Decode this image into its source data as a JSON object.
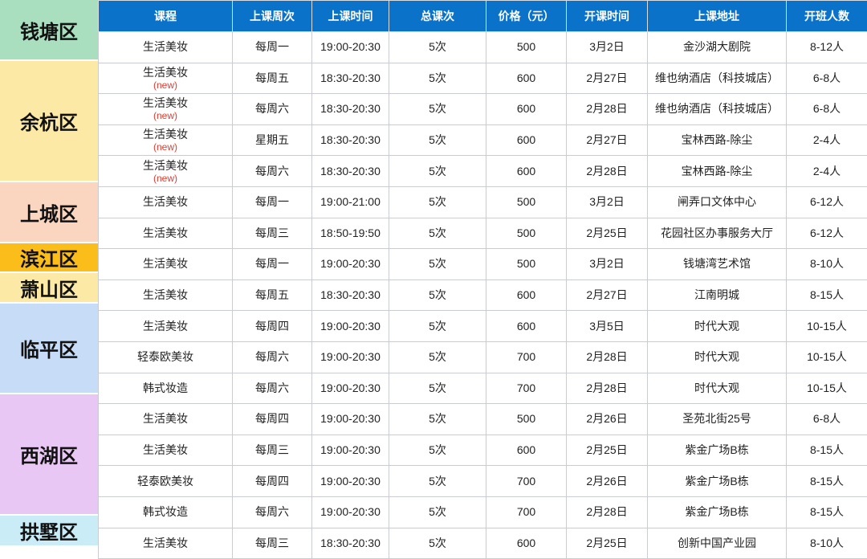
{
  "headers": [
    "课程",
    "上课周次",
    "上课时间",
    "总课次",
    "价格（元）",
    "开课时间",
    "上课地址",
    "开班人数"
  ],
  "districts": [
    {
      "name": "钱塘区",
      "color": "#a9dfbf"
    },
    {
      "name": "余杭区",
      "color": "#fde9a6"
    },
    {
      "name": "上城区",
      "color": "#fad5c0"
    },
    {
      "name": "滨江区",
      "color": "#fbbd1a"
    },
    {
      "name": "萧山区",
      "color": "#fde9a6"
    },
    {
      "name": "临平区",
      "color": "#c7dcf7"
    },
    {
      "name": "西湖区",
      "color": "#e8c7f4"
    },
    {
      "name": "拱墅区",
      "color": "#c9ecf7"
    }
  ],
  "rows": [
    {
      "course": "生活美妆",
      "tag": "",
      "weekday": "每周一",
      "time": "19:00-20:30",
      "sessions": "5次",
      "price": "500",
      "start": "3月2日",
      "address": "金沙湖大剧院",
      "size": "8-12人"
    },
    {
      "course": "生活美妆",
      "tag": "(new)",
      "weekday": "每周五",
      "time": "18:30-20:30",
      "sessions": "5次",
      "price": "600",
      "start": "2月27日",
      "address": "维也纳酒店（科技城店）",
      "size": "6-8人"
    },
    {
      "course": "生活美妆",
      "tag": "(new)",
      "weekday": "每周六",
      "time": "18:30-20:30",
      "sessions": "5次",
      "price": "600",
      "start": "2月28日",
      "address": "维也纳酒店（科技城店）",
      "size": "6-8人"
    },
    {
      "course": "生活美妆",
      "tag": "(new)",
      "weekday": "星期五",
      "time": "18:30-20:30",
      "sessions": "5次",
      "price": "600",
      "start": "2月27日",
      "address": "宝林西路-除尘",
      "size": "2-4人"
    },
    {
      "course": "生活美妆",
      "tag": "(new)",
      "weekday": "每周六",
      "time": "18:30-20:30",
      "sessions": "5次",
      "price": "600",
      "start": "2月28日",
      "address": "宝林西路-除尘",
      "size": "2-4人"
    },
    {
      "course": "生活美妆",
      "tag": "",
      "weekday": "每周一",
      "time": "19:00-21:00",
      "sessions": "5次",
      "price": "500",
      "start": "3月2日",
      "address": "闸弄口文体中心",
      "size": "6-12人"
    },
    {
      "course": "生活美妆",
      "tag": "",
      "weekday": "每周三",
      "time": "18:50-19:50",
      "sessions": "5次",
      "price": "500",
      "start": "2月25日",
      "address": "花园社区办事服务大厅",
      "size": "6-12人"
    },
    {
      "course": "生活美妆",
      "tag": "",
      "weekday": "每周一",
      "time": "19:00-20:30",
      "sessions": "5次",
      "price": "500",
      "start": "3月2日",
      "address": "钱塘湾艺术馆",
      "size": "8-10人"
    },
    {
      "course": "生活美妆",
      "tag": "",
      "weekday": "每周五",
      "time": "18:30-20:30",
      "sessions": "5次",
      "price": "600",
      "start": "2月27日",
      "address": "江南明城",
      "size": "8-15人"
    },
    {
      "course": "生活美妆",
      "tag": "",
      "weekday": "每周四",
      "time": "19:00-20:30",
      "sessions": "5次",
      "price": "600",
      "start": "3月5日",
      "address": "时代大观",
      "size": "10-15人"
    },
    {
      "course": "轻泰欧美妆",
      "tag": "",
      "weekday": "每周六",
      "time": "19:00-20:30",
      "sessions": "5次",
      "price": "700",
      "start": "2月28日",
      "address": "时代大观",
      "size": "10-15人"
    },
    {
      "course": "韩式妆造",
      "tag": "",
      "weekday": "每周六",
      "time": "19:00-20:30",
      "sessions": "5次",
      "price": "700",
      "start": "2月28日",
      "address": "时代大观",
      "size": "10-15人"
    },
    {
      "course": "生活美妆",
      "tag": "",
      "weekday": "每周四",
      "time": "19:00-20:30",
      "sessions": "5次",
      "price": "500",
      "start": "2月26日",
      "address": "圣苑北街25号",
      "size": "6-8人"
    },
    {
      "course": "生活美妆",
      "tag": "",
      "weekday": "每周三",
      "time": "19:00-20:30",
      "sessions": "5次",
      "price": "600",
      "start": "2月25日",
      "address": "紫金广场B栋",
      "size": "8-15人"
    },
    {
      "course": "轻泰欧美妆",
      "tag": "",
      "weekday": "每周四",
      "time": "19:00-20:30",
      "sessions": "5次",
      "price": "700",
      "start": "2月26日",
      "address": "紫金广场B栋",
      "size": "8-15人"
    },
    {
      "course": "韩式妆造",
      "tag": "",
      "weekday": "每周六",
      "time": "19:00-20:30",
      "sessions": "5次",
      "price": "700",
      "start": "2月28日",
      "address": "紫金广场B栋",
      "size": "8-15人"
    },
    {
      "course": "生活美妆",
      "tag": "",
      "weekday": "每周三",
      "time": "18:30-20:30",
      "sessions": "5次",
      "price": "600",
      "start": "2月25日",
      "address": "创新中国产业园",
      "size": "8-10人"
    }
  ]
}
